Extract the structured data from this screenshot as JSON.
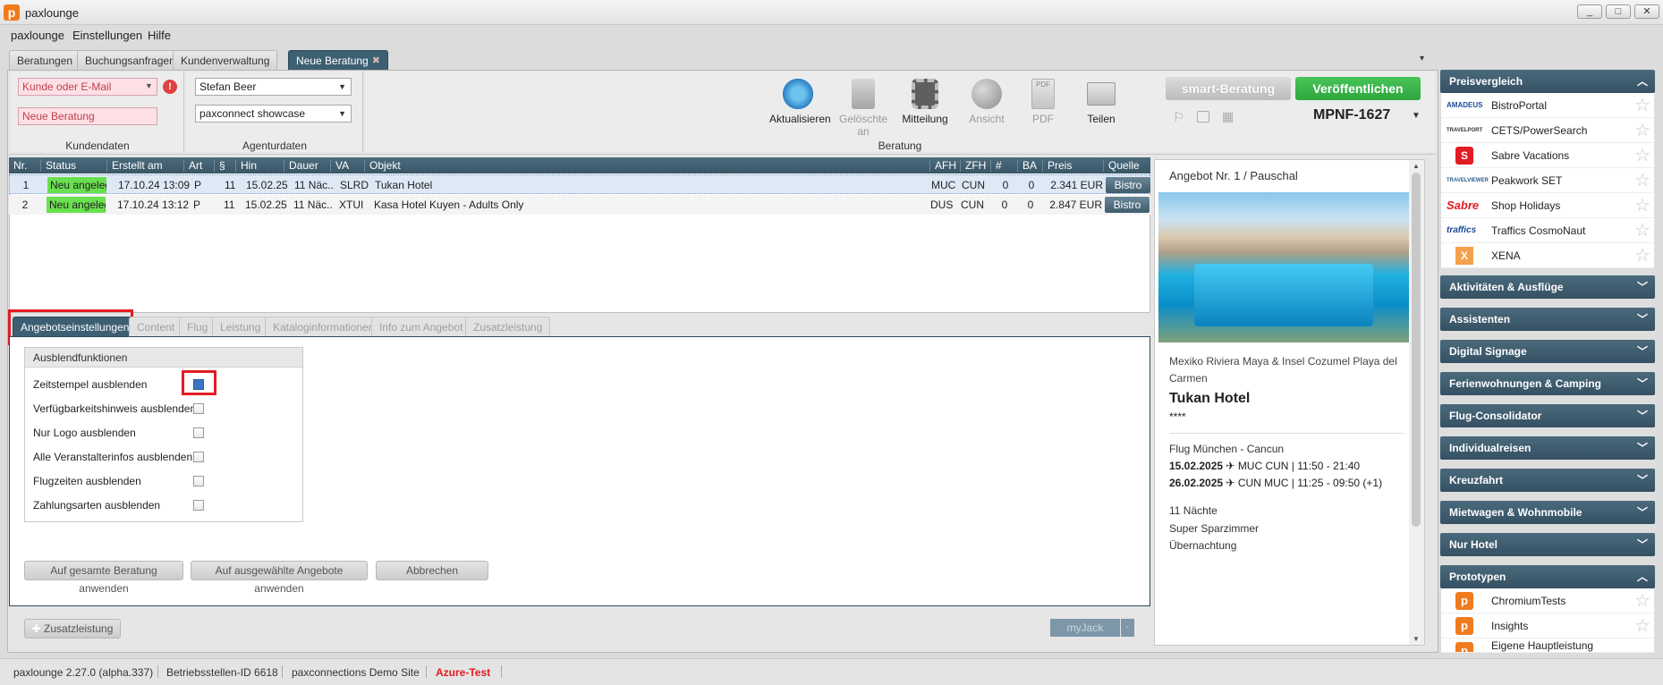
{
  "window": {
    "title": "paxlounge",
    "logo_letter": "p",
    "minimize": "_",
    "maximize": "□",
    "close": "✕"
  },
  "menu": [
    "paxlounge",
    "Einstellungen",
    "Hilfe"
  ],
  "tabs": [
    {
      "label": "Beratungen",
      "active": false
    },
    {
      "label": "Buchungsanfragen",
      "active": false
    },
    {
      "label": "Kundenverwaltung",
      "active": false
    },
    {
      "label": "Neue Beratung",
      "active": true,
      "close": "✖"
    }
  ],
  "customer": {
    "search_placeholder": "Kunde oder E-Mail",
    "name_placeholder": "Neue Beratung",
    "error_icon": "!",
    "section_label": "Kundendaten"
  },
  "agent": {
    "agent": "Stefan Beer",
    "agency": "paxconnect showcase",
    "section_label": "Agenturdaten"
  },
  "toolbar": {
    "buttons": [
      {
        "label": "Aktualisieren",
        "icon": "refresh-icon",
        "enabled": true
      },
      {
        "label": "Gelöschte an",
        "icon": "trash-icon",
        "enabled": false
      },
      {
        "label": "Mitteilung",
        "icon": "film-icon",
        "enabled": true
      },
      {
        "label": "Ansicht",
        "icon": "globe-icon",
        "enabled": false
      },
      {
        "label": "PDF",
        "icon": "pdf-icon",
        "enabled": false
      },
      {
        "label": "Teilen",
        "icon": "mail-icon",
        "enabled": true
      }
    ],
    "section_label": "Beratung",
    "smart_label": "smart-Beratung",
    "publish_label": "Veröffentlichen",
    "code": "MPNF-1627",
    "pdf_badge": "PDF"
  },
  "grid": {
    "columns": [
      "Nr.",
      "Status",
      "Erstellt am",
      "Art",
      "§",
      "Hin",
      "Dauer",
      "VA",
      "Objekt",
      "AFH",
      "ZFH",
      "#",
      "BA",
      "Preis",
      "Quelle"
    ],
    "rows": [
      {
        "nr": "1",
        "status": "Neu angelegt",
        "created": "17.10.24 13:09",
        "art": "P",
        "para": "11",
        "hin": "15.02.25",
        "dauer": "11 Näc...",
        "va": "SLRD",
        "objekt": "Tukan Hotel",
        "afh": "MUC",
        "zfh": "CUN",
        "count": "0",
        "ba": "0",
        "preis": "2.341 EUR",
        "quelle": "Bistro"
      },
      {
        "nr": "2",
        "status": "Neu angelegt",
        "created": "17.10.24 13:12",
        "art": "P",
        "para": "11",
        "hin": "15.02.25",
        "dauer": "11 Näc...",
        "va": "XTUI",
        "objekt": "Kasa Hotel Kuyen - Adults Only",
        "afh": "DUS",
        "zfh": "CUN",
        "count": "0",
        "ba": "0",
        "preis": "2.847 EUR",
        "quelle": "Bistro"
      }
    ]
  },
  "bottom_tabs": [
    "Angebotseinstellungen",
    "Content",
    "Flug",
    "Leistung",
    "Kataloginformationen",
    "Info zum Angebot",
    "Zusatzleistung"
  ],
  "hide_options": {
    "title": "Ausblendfunktionen",
    "items": [
      {
        "label": "Zeitstempel ausblenden"
      },
      {
        "label": "Verfügbarkeitshinweis ausblenden"
      },
      {
        "label": "Nur Logo ausblenden"
      },
      {
        "label": "Alle Veranstalterinfos ausblenden"
      },
      {
        "label": "Flugzeiten ausblenden"
      },
      {
        "label": "Zahlungsarten ausblenden"
      }
    ]
  },
  "actions": {
    "apply_all": "Auf gesamte Beratung anwenden",
    "apply_selected": "Auf ausgewählte Angebote anwenden",
    "cancel": "Abbrechen",
    "extra": "Zusatzleistung",
    "myjack": "myJack"
  },
  "offer": {
    "header": "Angebot Nr. 1 / Pauschal",
    "destination": "Mexiko Riviera Maya & Insel Cozumel Playa del Carmen",
    "hotel": "Tukan Hotel",
    "stars": "****",
    "flight_title": "Flug München - Cancun",
    "outbound_date": "15.02.2025",
    "outbound_info": "MUC CUN | 11:50 - 21:40",
    "return_date": "26.02.2025",
    "return_info": "CUN MUC | 11:25 - 09:50 (+1)",
    "nights": "11 Nächte",
    "room": "Super Sparzimmer",
    "board": "Übernachtung"
  },
  "sidebar": {
    "price_compare": {
      "title": "Preisvergleich",
      "items": [
        {
          "logo": "AMADEUS",
          "label": "BistroPortal"
        },
        {
          "logo": "TRAVELPORT",
          "label": "CETS/PowerSearch"
        },
        {
          "logo": "S",
          "label": "Sabre Vacations"
        },
        {
          "logo": "TRAVELVIEWER",
          "label": "Peakwork SET"
        },
        {
          "logo": "Sabre",
          "label": "Shop Holidays"
        },
        {
          "logo": "traffics",
          "label": "Traffics CosmoNaut"
        },
        {
          "logo": "X",
          "label": "XENA"
        }
      ]
    },
    "sections": [
      "Aktivitäten & Ausflüge",
      "Assistenten",
      "Digital Signage",
      "Ferienwohnungen & Camping",
      "Flug-Consolidator",
      "Individualreisen",
      "Kreuzfahrt",
      "Mietwagen & Wohnmobile",
      "Nur Hotel"
    ],
    "prototypes": {
      "title": "Prototypen",
      "items": [
        {
          "logo": "p",
          "label": "ChromiumTests"
        },
        {
          "logo": "p",
          "label": "Insights"
        },
        {
          "logo": "p",
          "label": "Eigene Hauptleistung"
        }
      ]
    }
  },
  "status": {
    "version": "paxlounge 2.27.0 (alpha.337)",
    "branch": "Betriebsstellen-ID 6618",
    "site": "paxconnections Demo Site",
    "env": "Azure-Test"
  },
  "colors": {
    "header_blue": "#3d5f73",
    "status_green": "#69e04f",
    "publish_green": "#39b54a",
    "highlight_red": "#e31b23"
  }
}
